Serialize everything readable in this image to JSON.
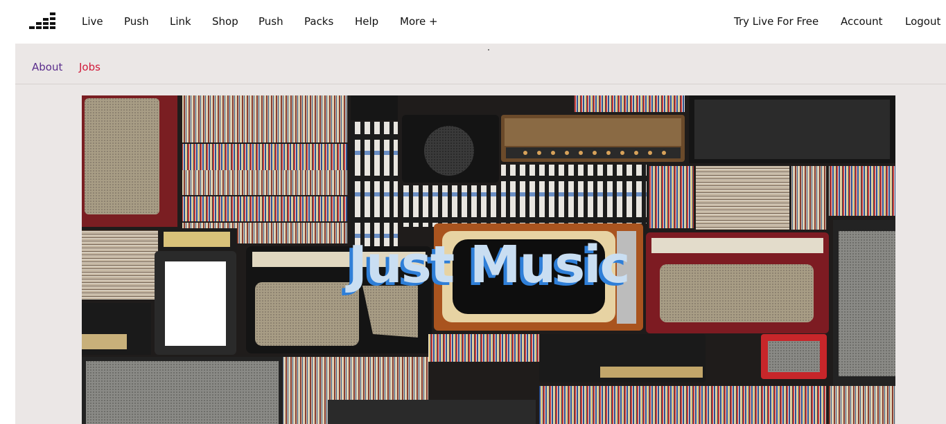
{
  "nav": {
    "logo_icon": "equalizer-bars-logo-icon",
    "links": [
      "Live",
      "Push",
      "Link",
      "Shop",
      "Push",
      "Packs",
      "Help",
      "More +"
    ],
    "right_links": [
      "Try Live For Free",
      "Account",
      "Logout"
    ]
  },
  "subnav": {
    "about": "About",
    "jobs": "Jobs"
  },
  "hero": {
    "title": "Just Music",
    "image": "wall-of-amplifiers-records-and-cassettes-photo"
  },
  "colors": {
    "about_link": "#5a2d8c",
    "jobs_link": "#d11a3a",
    "subbar_bg": "#ebe7e6",
    "hero_title": "#c9def2",
    "hero_title_shadow": "#2f7fd8"
  }
}
